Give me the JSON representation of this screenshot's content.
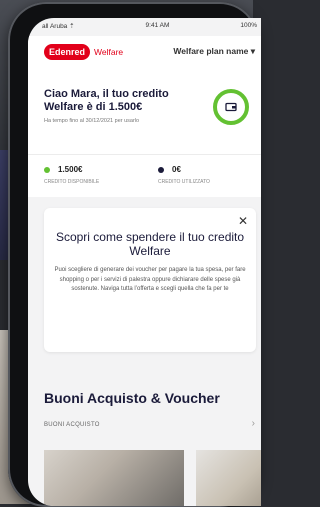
{
  "status_bar": {
    "carrier": "all Aruba ⇡",
    "time": "9:41 AM",
    "battery": "100%"
  },
  "header": {
    "logo": "Edenred",
    "logo_sub": "Welfare",
    "plan_menu": "Welfare plan name ▾"
  },
  "credit": {
    "greeting": "Ciao Mara, il tuo credito Welfare è di 1.500€",
    "expiry": "Ha tempo fino al 30/12/2021 per usarlo",
    "wallet_icon": "wallet-icon"
  },
  "balances": [
    {
      "amount": "1.500€",
      "label": "CREDITO DISPONIBILE",
      "color": "#63c132"
    },
    {
      "amount": "0€",
      "label": "CREDITO UTILIZZATO",
      "color": "#1b1b3a"
    }
  ],
  "promo": {
    "title": "Scopri come spendere il tuo credito Welfare",
    "text": "Puoi scegliere di generare dei voucher per pagare la tua spesa, per fare shopping o per i servizi di palestra oppure dichiarare delle spese già sostenute. Naviga tutta l’offerta e scegli quella che fa per te",
    "close_icon": "close-icon"
  },
  "section": {
    "title": "Buoni Acquisto & Voucher",
    "subtitle": "BUONI ACQUISTO"
  }
}
